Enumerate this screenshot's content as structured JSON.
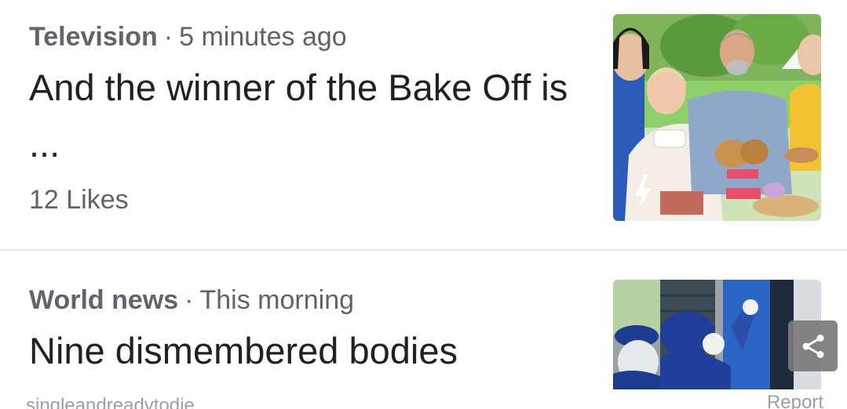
{
  "articles": [
    {
      "category": "Television",
      "separator": "·",
      "time": "5 minutes ago",
      "title": "And the winner of the Bake Off is ...",
      "likes": "12 Likes",
      "thumbnail": "bake-off-hosts-photo"
    },
    {
      "category": "World news",
      "separator": "·",
      "time": "This morning",
      "title": "Nine dismembered bodies",
      "thumbnail": "police-officers-photo",
      "source": "singleandreadytodie",
      "report_label": "Report"
    }
  ],
  "share_icon": "share-icon",
  "colors": {
    "meta": "#5f6368",
    "title": "#202124",
    "divider": "#e6e6e6",
    "share_bg": "#7b7b7b"
  }
}
